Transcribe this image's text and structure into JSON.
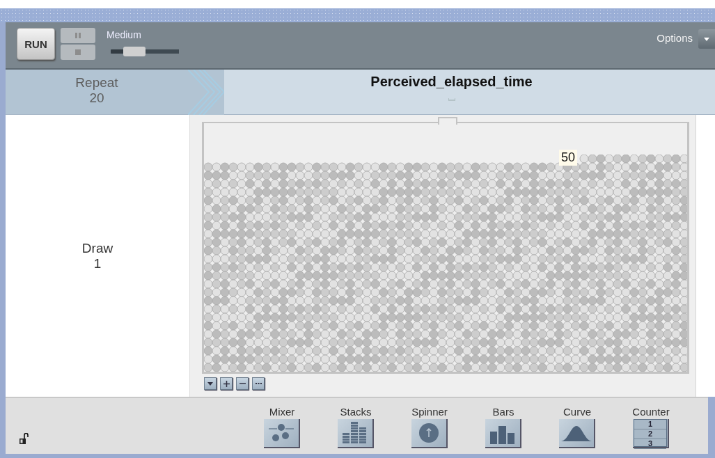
{
  "toolbar": {
    "run_label": "RUN",
    "pause": {
      "disabled": true
    },
    "stop": {
      "disabled": true
    },
    "speed": {
      "label": "Medium",
      "level": 0.35
    },
    "options_label": "Options"
  },
  "header": {
    "repeat_label": "Repeat",
    "repeat_value": "20",
    "title": "Perceived_elapsed_time"
  },
  "draw": {
    "label": "Draw",
    "value": "1"
  },
  "mixer": {
    "count_label": "50"
  },
  "devices": [
    {
      "kind": "mixer",
      "label": "Mixer"
    },
    {
      "kind": "stacks",
      "label": "Stacks"
    },
    {
      "kind": "spinner",
      "label": "Spinner"
    },
    {
      "kind": "bars",
      "label": "Bars"
    },
    {
      "kind": "curve",
      "label": "Curve"
    },
    {
      "kind": "counter",
      "label": "Counter",
      "digits": [
        "1",
        "2",
        "3"
      ]
    }
  ],
  "locked": false
}
